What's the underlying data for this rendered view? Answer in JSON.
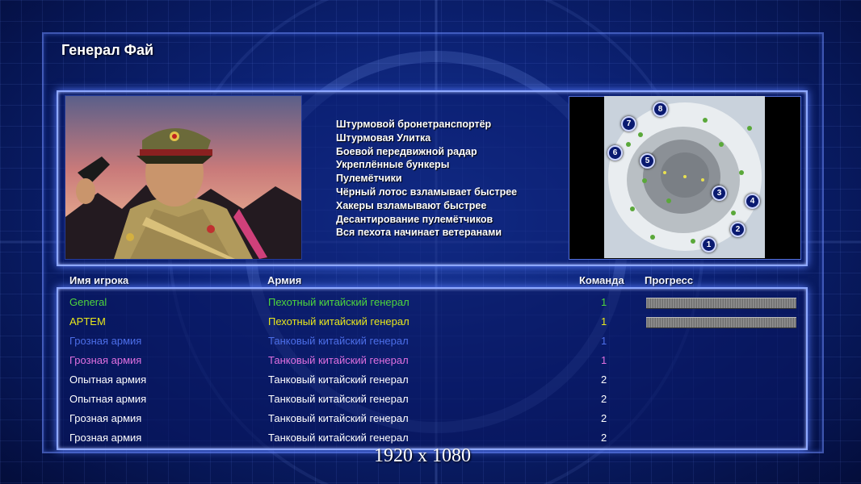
{
  "title": "Генерал Фай",
  "features": [
    "Штурмовой бронетранспортёр",
    "Штурмовая Улитка",
    "Боевой передвижной радар",
    "Укреплённые бункеры",
    "Пулемётчики",
    "Чёрный лотос взламывает быстрее",
    "Хакеры взламывают быстрее",
    "Десантирование пулемётчиков",
    "Вся пехота начинает ветеранами"
  ],
  "map": {
    "start_positions": [
      "1",
      "2",
      "3",
      "4",
      "5",
      "6",
      "7",
      "8"
    ]
  },
  "columns": {
    "name": "Имя игрока",
    "army": "Армия",
    "team": "Команда",
    "progress": "Прогресс"
  },
  "players": [
    {
      "name": "General",
      "army": "Пехотный китайский генерал",
      "team": "1",
      "color": "#4fd63c",
      "progress": 1.0
    },
    {
      "name": "APTEM",
      "army": "Пехотный китайский генерал",
      "team": "1",
      "color": "#e8e81c",
      "progress": 1.0
    },
    {
      "name": "Грозная армия",
      "army": "Танковый китайский генерал",
      "team": "1",
      "color": "#4c6ee8",
      "progress": null
    },
    {
      "name": "Грозная армия",
      "army": "Танковый китайский генерал",
      "team": "1",
      "color": "#e070e0",
      "progress": null
    },
    {
      "name": "Опытная армия",
      "army": "Танковый китайский генерал",
      "team": "2",
      "color": "#ffffff",
      "progress": null
    },
    {
      "name": "Опытная армия",
      "army": "Танковый китайский генерал",
      "team": "2",
      "color": "#ffffff",
      "progress": null
    },
    {
      "name": "Грозная армия",
      "army": "Танковый китайский генерал",
      "team": "2",
      "color": "#ffffff",
      "progress": null
    },
    {
      "name": "Грозная армия",
      "army": "Танковый китайский генерал",
      "team": "2",
      "color": "#ffffff",
      "progress": null
    }
  ],
  "resolution_label": "1920 x 1080"
}
